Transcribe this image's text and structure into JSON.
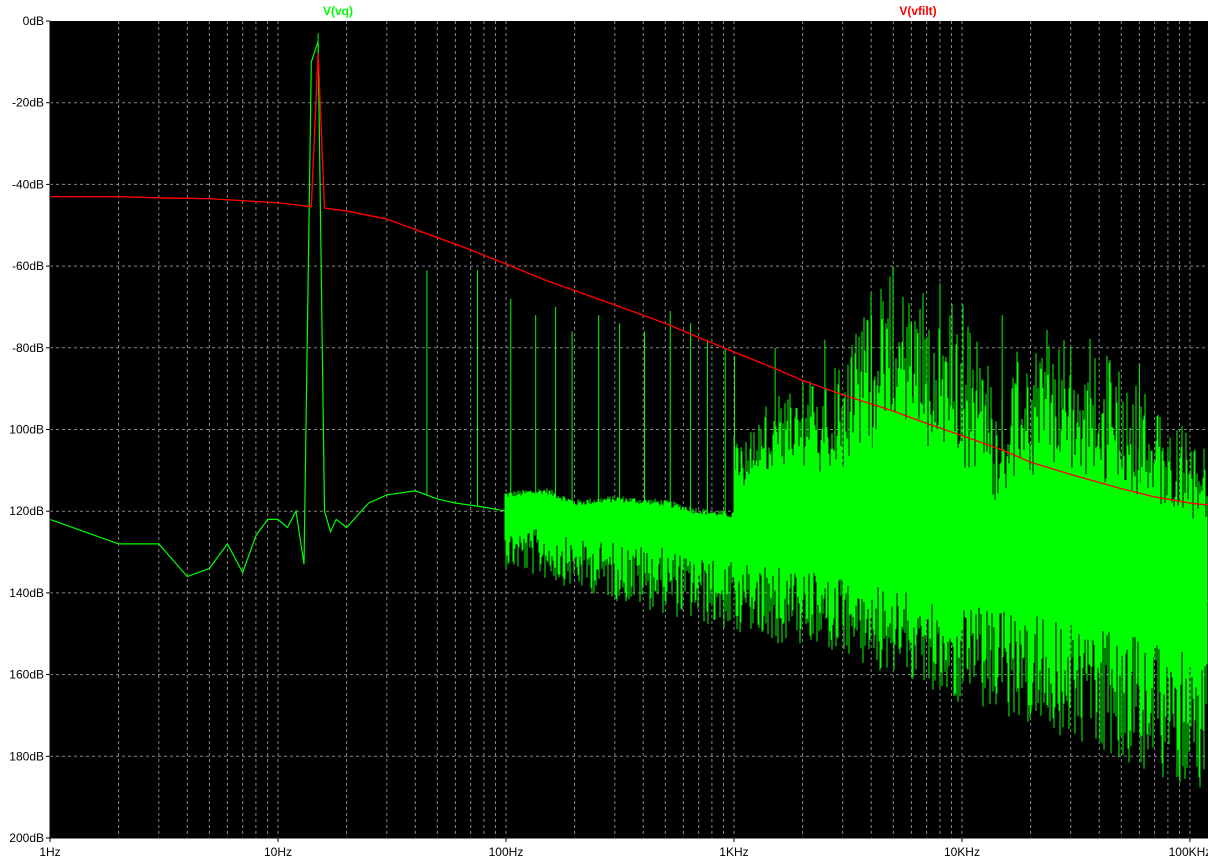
{
  "chart_data": {
    "type": "line",
    "title": "",
    "xlabel": "",
    "ylabel": "",
    "x_scale": "log",
    "xlim": [
      1,
      120000
    ],
    "ylim": [
      -200,
      0
    ],
    "grid": true,
    "legend_placement": "top",
    "background": "#000000",
    "grid_color": "#888888",
    "x_ticks": [
      {
        "value": 1,
        "label": "1Hz"
      },
      {
        "value": 10,
        "label": "10Hz"
      },
      {
        "value": 100,
        "label": "100Hz"
      },
      {
        "value": 1000,
        "label": "1KHz"
      },
      {
        "value": 10000,
        "label": "10KHz"
      },
      {
        "value": 100000,
        "label": "100KHz"
      }
    ],
    "y_ticks": [
      {
        "value": 0,
        "label": "0dB"
      },
      {
        "value": -20,
        "label": "-20dB"
      },
      {
        "value": -40,
        "label": "-40dB"
      },
      {
        "value": -60,
        "label": "-60dB"
      },
      {
        "value": -80,
        "label": "-80dB"
      },
      {
        "value": -100,
        "label": "100dB"
      },
      {
        "value": -120,
        "label": "120dB"
      },
      {
        "value": -140,
        "label": "140dB"
      },
      {
        "value": -160,
        "label": "160dB"
      },
      {
        "value": -180,
        "label": "180dB"
      },
      {
        "value": -200,
        "label": "200dB"
      }
    ],
    "series": [
      {
        "name": "V(vq)",
        "color": "#00ff00",
        "x": [
          1,
          2,
          3,
          4,
          5,
          6,
          7,
          8,
          9,
          10,
          11,
          12,
          13,
          14,
          15,
          16,
          17,
          18,
          20,
          25,
          30,
          40,
          50,
          60,
          80,
          100,
          150,
          200,
          300,
          500,
          700,
          1000,
          2000,
          3000,
          5000,
          7000,
          10000,
          15000,
          20000,
          30000,
          50000,
          70000,
          100000,
          120000
        ],
        "y": [
          -122,
          -128,
          -128,
          -136,
          -134,
          -128,
          -135,
          -126,
          -122,
          -122,
          -124,
          -120,
          -133,
          -10,
          -5,
          -120,
          -125,
          -122,
          -124,
          -118,
          -116,
          -115,
          -117,
          -118,
          -119,
          -120,
          -119,
          -122,
          -121,
          -122,
          -124,
          -125,
          -126,
          -128,
          -130,
          -131,
          -132,
          -133,
          -134,
          -135,
          -136,
          -138,
          -140,
          -142
        ],
        "spikes": [
          {
            "x": 15,
            "y": -3
          },
          {
            "x": 45,
            "y": -61
          },
          {
            "x": 75,
            "y": -61
          },
          {
            "x": 105,
            "y": -68
          },
          {
            "x": 135,
            "y": -72
          },
          {
            "x": 165,
            "y": -70
          },
          {
            "x": 195,
            "y": -76
          },
          {
            "x": 255,
            "y": -72
          },
          {
            "x": 315,
            "y": -74
          },
          {
            "x": 405,
            "y": -76
          },
          {
            "x": 525,
            "y": -71
          },
          {
            "x": 645,
            "y": -74
          },
          {
            "x": 765,
            "y": -78
          },
          {
            "x": 915,
            "y": -80
          },
          {
            "x": 1005,
            "y": -82
          },
          {
            "x": 1515,
            "y": -80
          },
          {
            "x": 2505,
            "y": -78
          },
          {
            "x": 4005,
            "y": -72
          },
          {
            "x": 6005,
            "y": -74
          },
          {
            "x": 9005,
            "y": -80
          },
          {
            "x": 15015,
            "y": -72
          },
          {
            "x": 30015,
            "y": -80
          },
          {
            "x": 60015,
            "y": -84
          }
        ],
        "noise_ceiling": [
          {
            "x": 1000,
            "y": -104
          },
          {
            "x": 2000,
            "y": -96
          },
          {
            "x": 3000,
            "y": -88
          },
          {
            "x": 4000,
            "y": -74
          },
          {
            "x": 7000,
            "y": -76
          },
          {
            "x": 10000,
            "y": -82
          },
          {
            "x": 12000,
            "y": -88
          },
          {
            "x": 15000,
            "y": -100
          },
          {
            "x": 20000,
            "y": -86
          },
          {
            "x": 25000,
            "y": -84
          },
          {
            "x": 30000,
            "y": -92
          },
          {
            "x": 40000,
            "y": -88
          },
          {
            "x": 50000,
            "y": -95
          },
          {
            "x": 70000,
            "y": -100
          },
          {
            "x": 100000,
            "y": -108
          },
          {
            "x": 120000,
            "y": -112
          }
        ],
        "noise_floor": [
          {
            "x": 100,
            "y": -134
          },
          {
            "x": 300,
            "y": -142
          },
          {
            "x": 1000,
            "y": -150
          },
          {
            "x": 2000,
            "y": -154
          },
          {
            "x": 5000,
            "y": -160
          },
          {
            "x": 10000,
            "y": -168
          },
          {
            "x": 20000,
            "y": -172
          },
          {
            "x": 50000,
            "y": -182
          },
          {
            "x": 100000,
            "y": -188
          },
          {
            "x": 120000,
            "y": -192
          }
        ]
      },
      {
        "name": "V(vfilt)",
        "color": "#ff0000",
        "x": [
          1,
          2,
          3,
          5,
          7,
          10,
          12,
          14,
          15,
          16,
          17,
          20,
          30,
          50,
          70,
          100,
          150,
          200,
          300,
          500,
          700,
          1000,
          1500,
          2000,
          3000,
          5000,
          7000,
          10000,
          15000,
          20000,
          30000,
          50000,
          70000,
          100000,
          120000
        ],
        "y": [
          -43,
          -43,
          -43.3,
          -43.5,
          -44,
          -44.5,
          -45,
          -45.5,
          -8,
          -45.8,
          -46,
          -46.5,
          -48.5,
          -53,
          -56,
          -59.5,
          -63.5,
          -66,
          -69.5,
          -74,
          -77.5,
          -81,
          -85,
          -88,
          -91.5,
          -95.5,
          -98.5,
          -101.5,
          -105,
          -108,
          -111,
          -114.5,
          -116.5,
          -118,
          -118.5
        ]
      }
    ]
  }
}
